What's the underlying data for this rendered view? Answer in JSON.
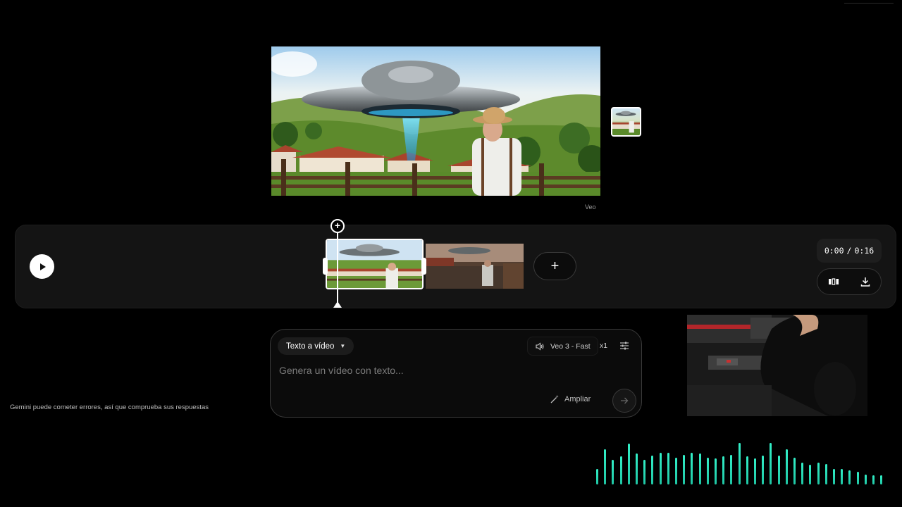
{
  "preview": {
    "caption": "Veo"
  },
  "timeline": {
    "current_time": "0:00",
    "separator": "/",
    "total_time": "0:16",
    "add_label": "+",
    "playhead_label": "+"
  },
  "prompt": {
    "mode": "Texto a vídeo",
    "model": "Veo 3 - Fast",
    "count": "x1",
    "placeholder": "Genera un vídeo con texto...",
    "expand_label": "Ampliar"
  },
  "disclaimer": "Gemini puede cometer errores, así que comprueba sus respuestas",
  "icons": {
    "play": "play-icon",
    "storyboard": "storyboard-icon",
    "download": "download-icon",
    "volume": "volume-icon",
    "settings": "sliders-icon",
    "expand": "magic-wand-icon",
    "send": "arrow-right-icon"
  },
  "colors": {
    "accent_audio": "#2ee6c0",
    "panel_bg": "#141414"
  },
  "audio_levels": [
    0.35,
    0.78,
    0.55,
    0.62,
    0.9,
    0.68,
    0.54,
    0.64,
    0.7,
    0.7,
    0.6,
    0.66,
    0.7,
    0.68,
    0.6,
    0.58,
    0.62,
    0.66,
    0.92,
    0.62,
    0.58,
    0.64,
    0.92,
    0.64,
    0.78,
    0.6,
    0.48,
    0.44,
    0.48,
    0.46,
    0.34,
    0.34,
    0.32,
    0.28,
    0.22,
    0.2,
    0.2
  ]
}
